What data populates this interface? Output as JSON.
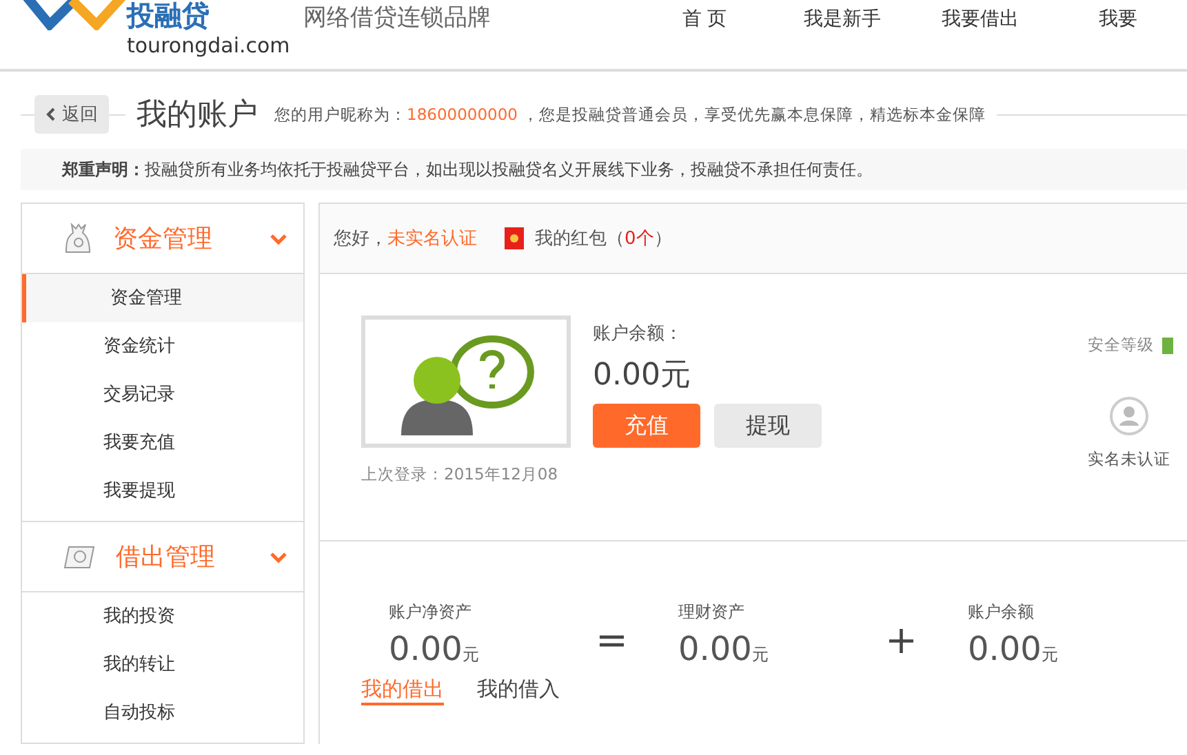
{
  "header": {
    "logo_text": "投融贷",
    "logo_domain": "tourongdai.com",
    "slogan": "网络借贷连锁品牌",
    "nav": [
      {
        "label": "首 页"
      },
      {
        "label": "我是新手"
      },
      {
        "label": "我要借出"
      },
      {
        "label": "我要"
      }
    ]
  },
  "title_bar": {
    "back": "返回",
    "title": "我的账户",
    "intro_prefix": "您的用户昵称为：",
    "nickname": "18600000000",
    "intro_suffix": "，您是投融贷普通会员，享受优先赢本息保障，精选标本金保障"
  },
  "notice": {
    "label": "郑重声明：",
    "text": "投融贷所有业务均依托于投融贷平台，如出现以投融贷名义开展线下业务，投融贷不承担任何责任。"
  },
  "sidebar": [
    {
      "title": "资金管理",
      "expanded": true,
      "items": [
        {
          "label": "资金管理",
          "selected": true
        },
        {
          "label": "资金统计",
          "selected": false
        },
        {
          "label": "交易记录",
          "selected": false
        },
        {
          "label": "我要充值",
          "selected": false
        },
        {
          "label": "我要提现",
          "selected": false
        }
      ]
    },
    {
      "title": "借出管理",
      "expanded": true,
      "items": [
        {
          "label": "我的投资",
          "selected": false
        },
        {
          "label": "我的转让",
          "selected": false
        },
        {
          "label": "自动投标",
          "selected": false
        }
      ]
    }
  ],
  "greeting": {
    "hello": "您好，",
    "status": "未实名认证",
    "red_packet_label": "我的红包（",
    "red_packet_count": "0个",
    "red_packet_close": "）"
  },
  "account": {
    "balance_label": "账户余额：",
    "balance": "0.00元",
    "recharge": "充值",
    "withdraw": "提现",
    "last_login": "上次登录：2015年12月08",
    "security_label": "安全等级",
    "verify_label": "实名未认证"
  },
  "summary": [
    {
      "label": "账户净资产",
      "value": "0.00",
      "unit": "元",
      "operator": "="
    },
    {
      "label": "理财资产",
      "value": "0.00",
      "unit": "元",
      "operator": "+"
    },
    {
      "label": "账户余额",
      "value": "0.00",
      "unit": "元"
    }
  ],
  "tabs": [
    {
      "label": "我的借出",
      "selected": true
    },
    {
      "label": "我的借入",
      "selected": false
    }
  ]
}
